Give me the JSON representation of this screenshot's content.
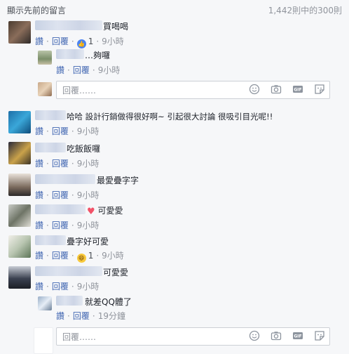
{
  "header": {
    "view_previous": "顯示先前的留言",
    "count": "1,442則中的300則"
  },
  "labels": {
    "like": "讚",
    "reply": "回覆",
    "reply_placeholder": "回覆……",
    "dot": "·"
  },
  "comments": [
    {
      "text": "買喝喝",
      "time": "9小時",
      "reactions": "1"
    },
    {
      "text": "…夠囉",
      "time": "9小時"
    },
    {
      "text": "哈哈 設計行銷做得很好啊~ 引起很大討論 很吸引目光呢!!",
      "time": "9小時"
    },
    {
      "text": "吃飯飯囉",
      "time": "9小時"
    },
    {
      "text": "最愛疊字字",
      "time": "9小時"
    },
    {
      "text": "可愛愛",
      "time": "9小時"
    },
    {
      "text": "疊字好可愛",
      "time": "9小時",
      "reactions": "1"
    },
    {
      "text": "可愛愛",
      "time": "9小時"
    },
    {
      "text": "就差QQ體了",
      "time": "19分鐘"
    }
  ],
  "icons": [
    "emoji-icon",
    "camera-icon",
    "gif-icon",
    "sticker-icon",
    "like-reaction-icon",
    "haha-reaction-icon",
    "heart-emoji-icon"
  ],
  "colors": {
    "link": "#4267b2",
    "muted": "#90949c",
    "background": "#f6f7f9"
  }
}
